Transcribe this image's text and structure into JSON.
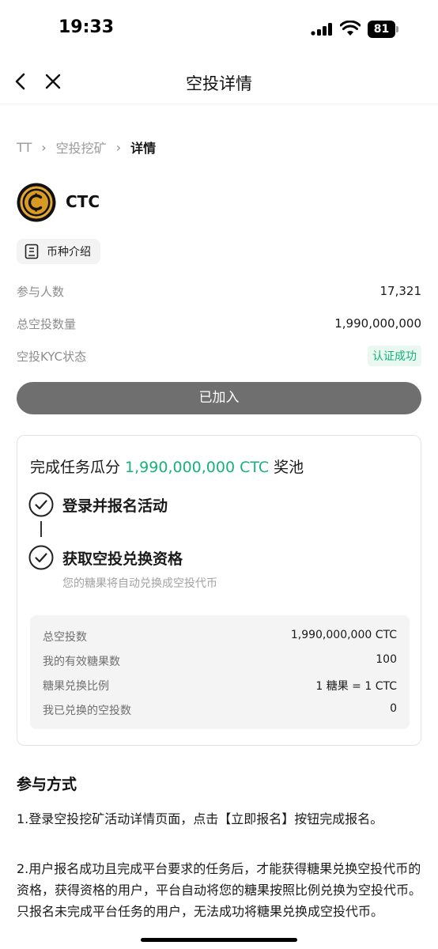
{
  "status_bar": {
    "time": "19:33",
    "battery": "81",
    "icons": [
      "signal-icon",
      "wifi-icon",
      "battery-icon"
    ]
  },
  "nav": {
    "title": "空投详情",
    "icons": [
      "back-icon",
      "close-icon"
    ]
  },
  "breadcrumb": {
    "items": [
      "TT",
      "空投挖矿"
    ],
    "current": "详情"
  },
  "coin": {
    "name": "CTC",
    "intro_label": "币种介绍"
  },
  "info": {
    "participants_label": "参与人数",
    "participants_value": "17,321",
    "total_label": "总空投数量",
    "total_value": "1,990,000,000",
    "kyc_label": "空投KYC状态",
    "kyc_value": "认证成功"
  },
  "joined_label": "已加入",
  "task": {
    "pool_prefix": "完成任务瓜分 ",
    "pool_amount": "1,990,000,000 CTC",
    "pool_suffix": " 奖池",
    "steps": [
      {
        "title": "登录并报名活动"
      },
      {
        "title": "获取空投兑换资格",
        "subtitle": "您的糖果将自动兑换成空投代币"
      }
    ],
    "stats": [
      {
        "label": "总空投数",
        "value": "1,990,000,000 CTC"
      },
      {
        "label": "我的有效糖果数",
        "value": "100"
      },
      {
        "label": "糖果兑换比例",
        "value": "1 糖果 = 1 CTC"
      },
      {
        "label": "我已兑换的空投数",
        "value": "0"
      }
    ]
  },
  "participation": {
    "title": "参与方式",
    "paragraphs": [
      "1.登录空投挖矿活动详情页面，点击【立即报名】按钮完成报名。",
      "2.用户报名成功且完成平台要求的任务后，才能获得糖果兑换空投代币的资格，获得资格的用户，平台自动将您的糖果按照比例兑换为空投代币。只报名未完成平台任务的用户，无法成功将糖果兑换成空投代币。"
    ]
  },
  "colors": {
    "accent_green": "#17b27a",
    "joined_button": "#6f6f6f",
    "muted_text": "#8c8c8c"
  }
}
